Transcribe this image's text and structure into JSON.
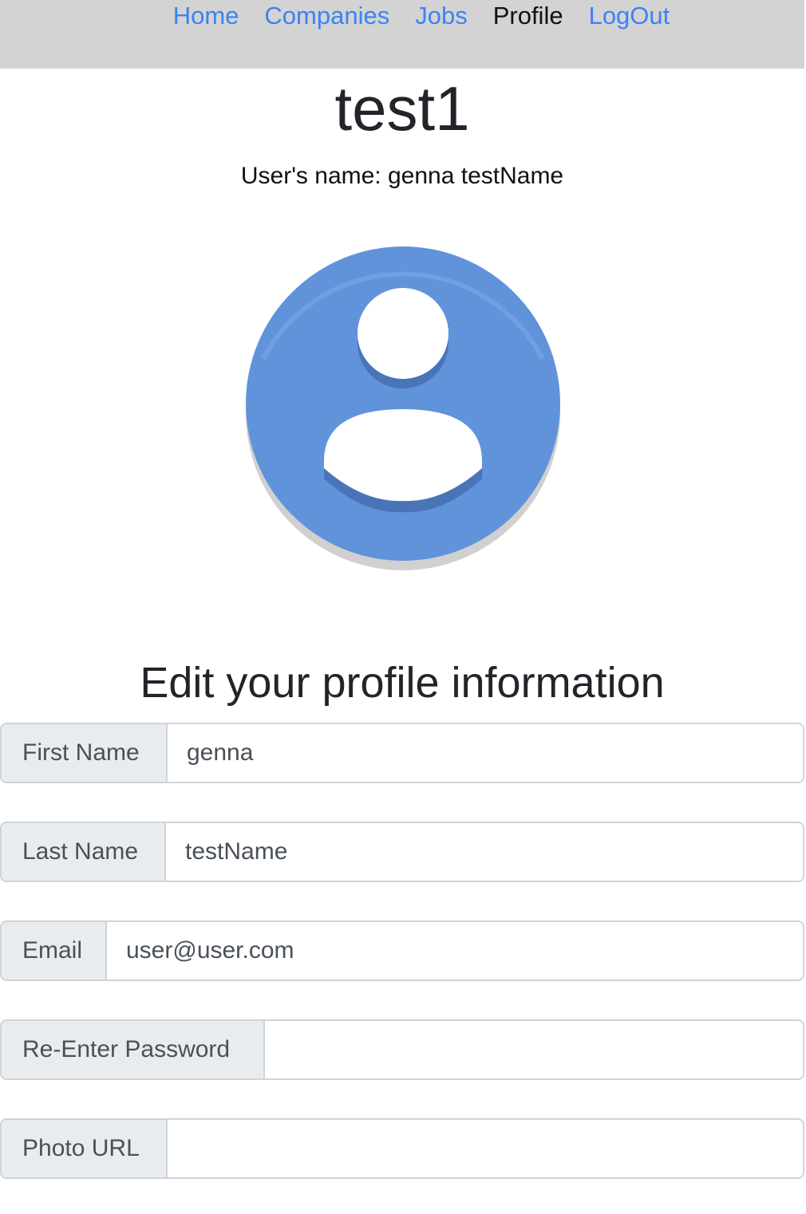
{
  "nav": {
    "items": [
      {
        "label": "Home",
        "active": false
      },
      {
        "label": "Companies",
        "active": false
      },
      {
        "label": "Jobs",
        "active": false
      },
      {
        "label": "Profile",
        "active": true
      },
      {
        "label": "LogOut",
        "active": false
      }
    ]
  },
  "profile": {
    "username": "test1",
    "full_name_line": "User's name: genna testName",
    "avatar_icon": "default-user-avatar-icon",
    "avatar_color": "#6193db"
  },
  "form": {
    "heading": "Edit your profile information",
    "fields": [
      {
        "label": "First Name",
        "value": "genna",
        "placeholder": ""
      },
      {
        "label": "Last Name",
        "value": "testName",
        "placeholder": ""
      },
      {
        "label": "Email",
        "value": "user@user.com",
        "placeholder": ""
      },
      {
        "label": "Re-Enter Password",
        "value": "",
        "placeholder": ""
      },
      {
        "label": "Photo URL",
        "value": "",
        "placeholder": ""
      }
    ]
  },
  "colors": {
    "navbar_bg": "#d3d3d3",
    "link": "#3b82f6",
    "label_bg": "#e9ecef",
    "border": "#ced4da"
  }
}
